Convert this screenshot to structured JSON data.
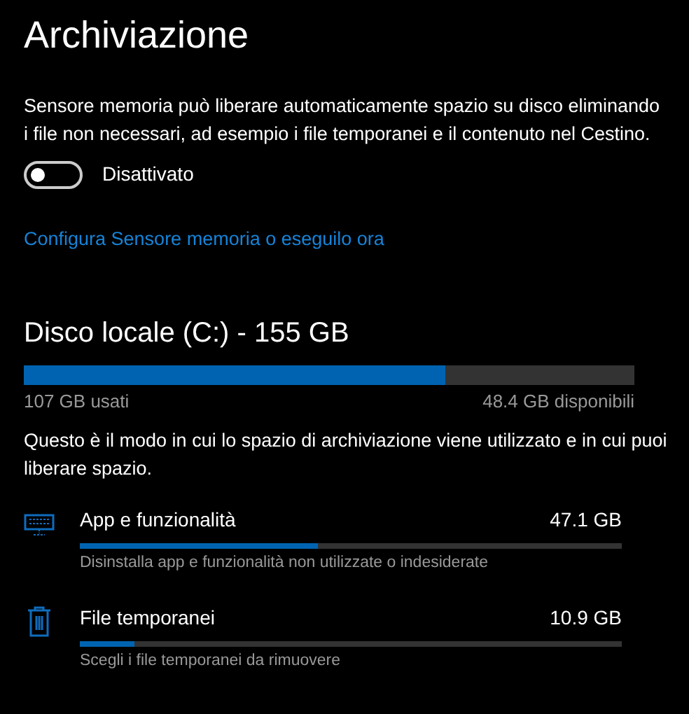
{
  "title": "Archiviazione",
  "description": "Sensore memoria può liberare automaticamente spazio su disco eliminando i file non necessari, ad esempio i file temporanei e il contenuto nel Cestino.",
  "toggle": {
    "label": "Disattivato",
    "on": false
  },
  "link": "Configura Sensore memoria o eseguilo ora",
  "disk": {
    "title": "Disco locale (C:) - 155 GB",
    "level": 0.69,
    "used": "107 GB usati",
    "free": "48.4 GB disponibili"
  },
  "explanation": "Questo è il modo in cui lo spazio di archiviazione viene utilizzato e in cui puoi liberare spazio.",
  "items": [
    {
      "kind": "apps",
      "name": "App e funzionalità",
      "size": "47.1 GB",
      "level": 0.44,
      "hint": "Disinstalla app e funzionalità non utilizzate o indesiderate"
    },
    {
      "kind": "temp",
      "name": "File temporanei",
      "size": "10.9 GB",
      "level": 0.1,
      "hint": "Scegli i file temporanei da rimuovere"
    }
  ]
}
